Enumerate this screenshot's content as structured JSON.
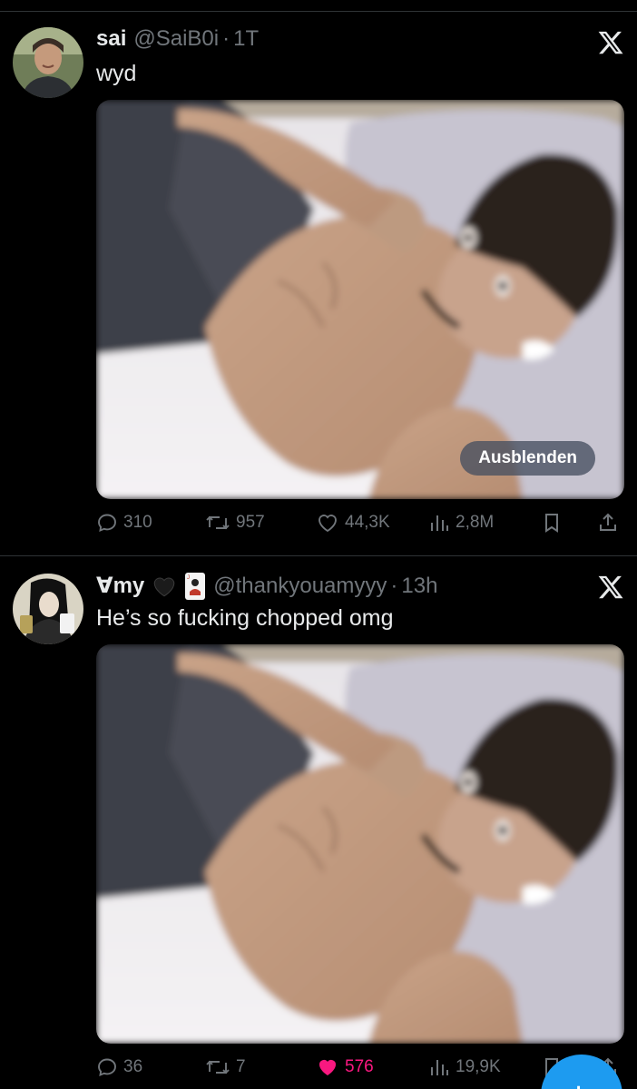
{
  "tweets": [
    {
      "name": "sai",
      "badges": [],
      "handle": "@SaiB0i",
      "separator": "·",
      "time": "1T",
      "text": "wyd",
      "media": {
        "sensitive_button": "Ausblenden",
        "description_icon": "photo"
      },
      "stats": {
        "replies": "310",
        "reposts": "957",
        "likes": "44,3K",
        "views": "2,8M"
      },
      "liked": false
    },
    {
      "name": "Ɐmy",
      "badges": [
        "black-heart",
        "joker-card"
      ],
      "handle": "@thankyouamyyy",
      "separator": "·",
      "time": "13h",
      "text": "He’s so fucking chopped omg",
      "media": {
        "description_icon": "photo"
      },
      "stats": {
        "replies": "36",
        "reposts": "7",
        "likes": "576",
        "views": "19,9K"
      },
      "liked": true
    }
  ],
  "colors": {
    "background": "#000000",
    "primary_text": "#e7e9ea",
    "secondary_text": "#71767b",
    "like_active": "#f91880",
    "accent": "#1d9bf0"
  },
  "icons": [
    "x-logo-icon",
    "reply-icon",
    "repost-icon",
    "like-icon",
    "views-icon",
    "bookmark-icon",
    "share-icon",
    "compose-icon"
  ]
}
